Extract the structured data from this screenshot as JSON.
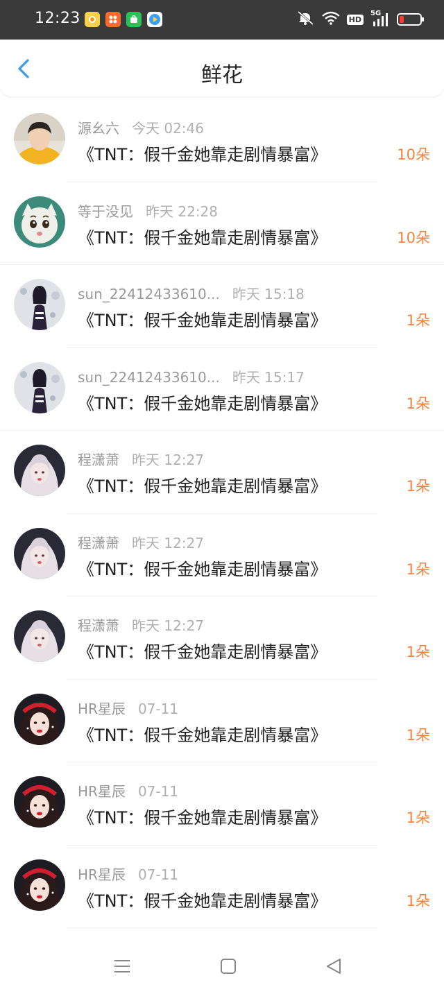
{
  "status_bar": {
    "time": "12:23",
    "network": "5G",
    "hd": "HD",
    "app_icons": [
      "weather-app-icon",
      "video-app-icon",
      "shop-app-icon",
      "media-app-icon"
    ],
    "app_colors": [
      "#f5d24a",
      "#ff6a2b",
      "#2dbf5a",
      "#3aa0ff"
    ]
  },
  "header": {
    "title": "鲜花",
    "back_icon": "chevron-left-icon"
  },
  "colors": {
    "accent": "#f5813a",
    "back": "#3a9be8",
    "status_bar_bg": "#3a3a3a"
  },
  "items": [
    {
      "name": "源幺六",
      "time": "今天 02:46",
      "book": "《TNT：假千金她靠走剧情暴富》",
      "amount": "10朵",
      "avatar": "boy-portrait"
    },
    {
      "name": "等于没见",
      "time": "昨天 22:28",
      "book": "《TNT：假千金她靠走剧情暴富》",
      "amount": "10朵",
      "avatar": "cartoon-face"
    },
    {
      "name": "sun_22412433610...",
      "time": "昨天 15:18",
      "book": "《TNT：假千金她靠走剧情暴富》",
      "amount": "1朵",
      "avatar": "girl-dark"
    },
    {
      "name": "sun_22412433610...",
      "time": "昨天 15:17",
      "book": "《TNT：假千金她靠走剧情暴富》",
      "amount": "1朵",
      "avatar": "girl-dark"
    },
    {
      "name": "程潇萧",
      "time": "昨天 12:27",
      "book": "《TNT：假千金她靠走剧情暴富》",
      "amount": "1朵",
      "avatar": "girl-silver"
    },
    {
      "name": "程潇萧",
      "time": "昨天 12:27",
      "book": "《TNT：假千金她靠走剧情暴富》",
      "amount": "1朵",
      "avatar": "girl-silver"
    },
    {
      "name": "程潇萧",
      "time": "昨天 12:27",
      "book": "《TNT：假千金她靠走剧情暴富》",
      "amount": "1朵",
      "avatar": "girl-silver"
    },
    {
      "name": "HR星辰",
      "time": "07-11",
      "book": "《TNT：假千金她靠走剧情暴富》",
      "amount": "1朵",
      "avatar": "girl-red"
    },
    {
      "name": "HR星辰",
      "time": "07-11",
      "book": "《TNT：假千金她靠走剧情暴富》",
      "amount": "1朵",
      "avatar": "girl-red"
    },
    {
      "name": "HR星辰",
      "time": "07-11",
      "book": "《TNT：假千金她靠走剧情暴富》",
      "amount": "1朵",
      "avatar": "girl-red"
    }
  ],
  "nav_bar": {
    "menu_icon": "menu-icon",
    "home_icon": "home-square-icon",
    "back_icon": "back-triangle-icon"
  }
}
